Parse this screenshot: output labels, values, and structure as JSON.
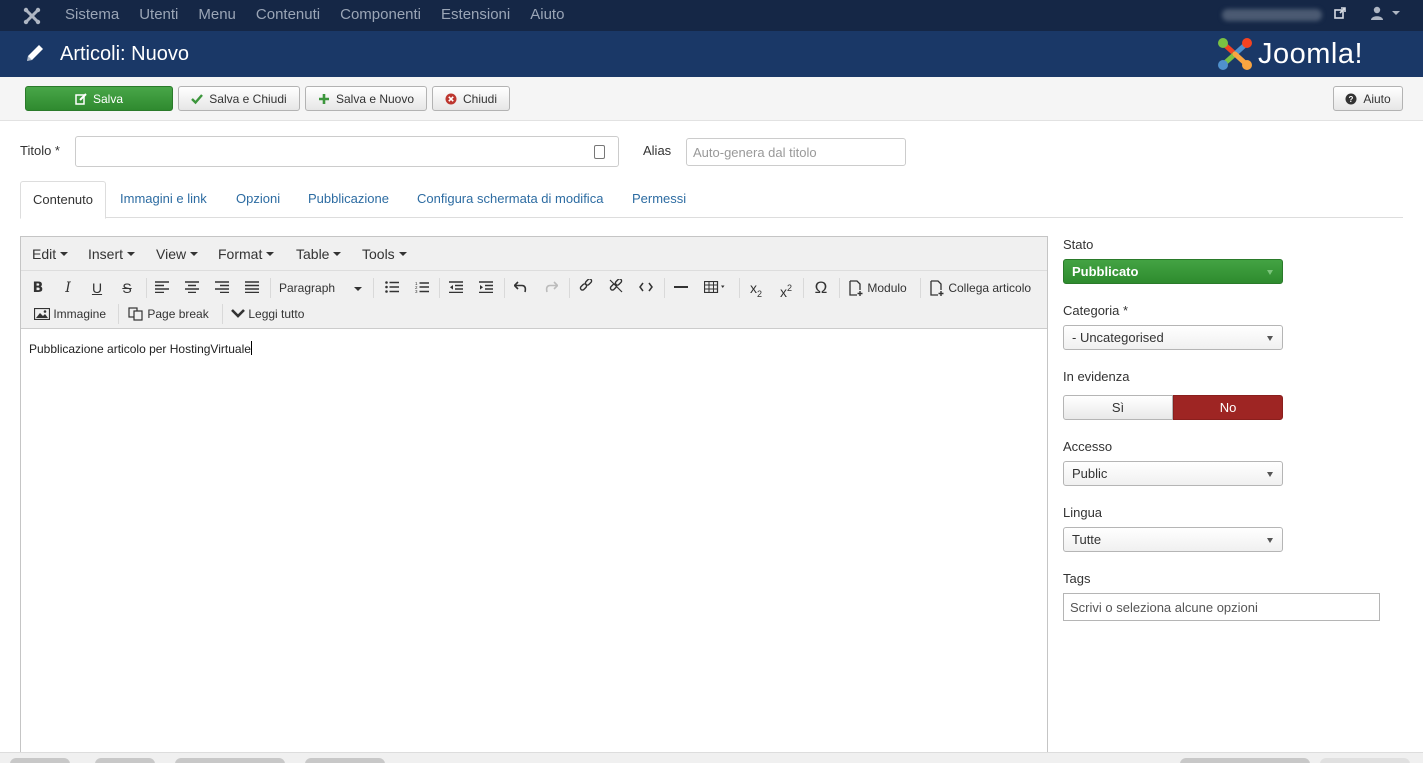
{
  "topnav": {
    "items": [
      "Sistema",
      "Utenti",
      "Menu",
      "Contenuti",
      "Componenti",
      "Estensioni",
      "Aiuto"
    ],
    "logo_icon": "joomla-icon",
    "external_icon": "external-link-icon",
    "user_icon": "user-icon"
  },
  "header": {
    "title": "Articoli: Nuovo",
    "brand": "Joomla!",
    "title_icon": "pencil-icon"
  },
  "toolbar": {
    "save": "Salva",
    "save_close": "Salva e Chiudi",
    "save_new": "Salva e Nuovo",
    "close": "Chiudi",
    "help": "Aiuto"
  },
  "form": {
    "title_label": "Titolo *",
    "title_value": "",
    "alias_label": "Alias",
    "alias_placeholder": "Auto-genera dal titolo"
  },
  "tabs": [
    "Contenuto",
    "Immagini e link",
    "Opzioni",
    "Pubblicazione",
    "Configura schermata di modifica",
    "Permessi"
  ],
  "editor": {
    "menus": [
      "Edit",
      "Insert",
      "View",
      "Format",
      "Table",
      "Tools"
    ],
    "format_select": "Paragraph",
    "buttons": {
      "module": "Modulo",
      "link_article": "Collega articolo",
      "image": "Immagine",
      "page_break": "Page break",
      "read_more": "Leggi tutto"
    },
    "content": "Pubblicazione articolo per HostingVirtuale"
  },
  "sidebar": {
    "stato_label": "Stato",
    "stato_value": "Pubblicato",
    "categoria_label": "Categoria *",
    "categoria_value": "- Uncategorised",
    "evidenza_label": "In evidenza",
    "evidenza_yes": "Sì",
    "evidenza_no": "No",
    "accesso_label": "Accesso",
    "accesso_value": "Public",
    "lingua_label": "Lingua",
    "lingua_value": "Tutte",
    "tags_label": "Tags",
    "tags_placeholder": "Scrivi o seleziona alcune opzioni"
  },
  "colors": {
    "nav_bg": "#152746",
    "header_bg": "#1a3867",
    "success": "#3c963c",
    "danger": "#9e2523",
    "link": "#2d6ca2"
  }
}
